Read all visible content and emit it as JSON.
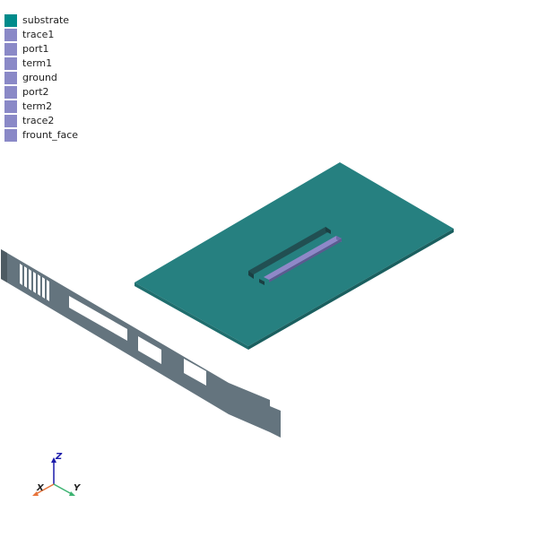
{
  "legend": {
    "items": [
      {
        "label": "substrate",
        "color": "#008b8b"
      },
      {
        "label": "trace1",
        "color": "#8a89c7"
      },
      {
        "label": "port1",
        "color": "#8a89c7"
      },
      {
        "label": "term1",
        "color": "#8a89c7"
      },
      {
        "label": "ground",
        "color": "#8a89c7"
      },
      {
        "label": "port2",
        "color": "#8a89c7"
      },
      {
        "label": "term2",
        "color": "#8a89c7"
      },
      {
        "label": "trace2",
        "color": "#8a89c7"
      },
      {
        "label": "frount_face",
        "color": "#8a89c7"
      }
    ]
  },
  "scene": {
    "substrate_color": "#268080",
    "substrate_edge_color": "#1d6666",
    "trace_color": "#8f88c8",
    "front_face_color": "#64747e",
    "background_color": "#ffffff"
  },
  "axes": {
    "x": {
      "label": "X",
      "color": "#e8743b"
    },
    "y": {
      "label": "Y",
      "color": "#3cb371"
    },
    "z": {
      "label": "Z",
      "color": "#1a1aaa"
    }
  }
}
